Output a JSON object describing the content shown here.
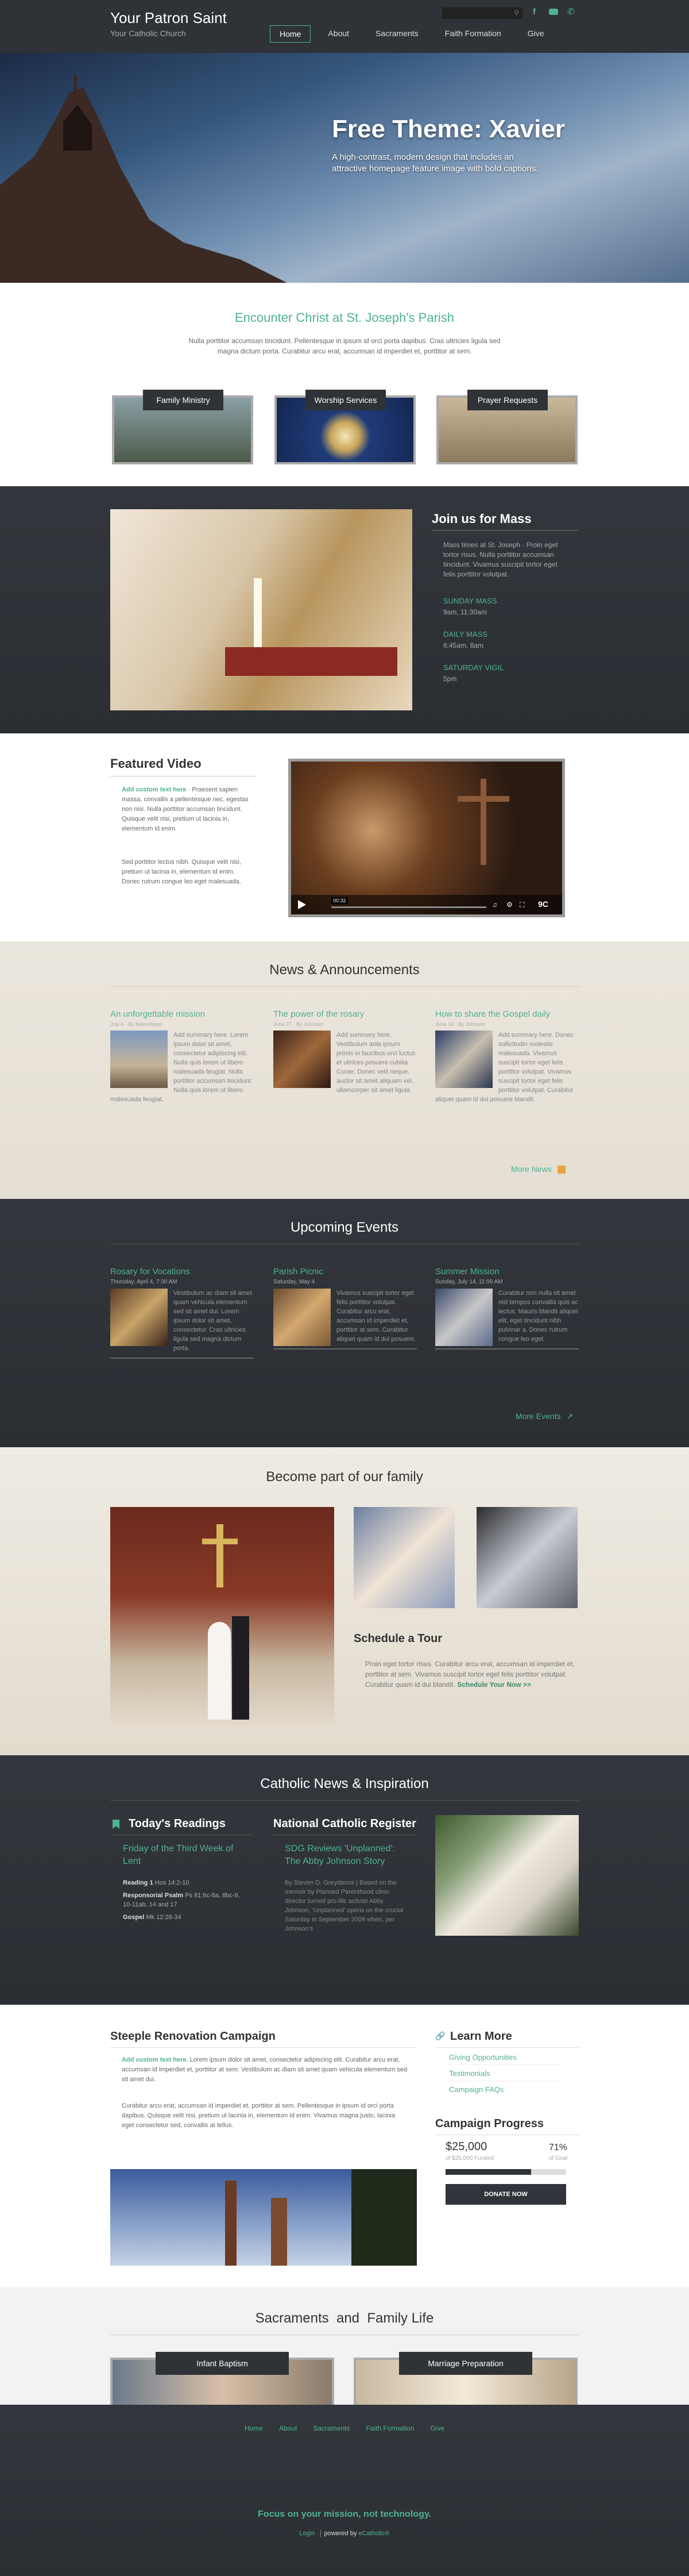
{
  "header": {
    "site_title": "Your Patron Saint",
    "site_subtitle": "Your Catholic Church",
    "nav": [
      "Home",
      "About",
      "Sacraments",
      "Faith Formation",
      "Give"
    ]
  },
  "hero": {
    "title": "Free Theme: Xavier",
    "subtitle": "A high-contrast, modern design that includes an attractive homepage feature image with bold captions."
  },
  "intro": {
    "heading": "Encounter Christ at St. Joseph's Parish",
    "text": "Nulla porttitor accumsan tincidunt. Pellentesque in ipsum id orci porta dapibus. Cras ultricies ligula sed magna dictum porta. Curabitur arcu erat, accumsan id imperdiet et, porttitor at sem.",
    "cards": [
      "Family Ministry",
      "Worship Services",
      "Prayer Requests"
    ]
  },
  "mass": {
    "heading": "Join us for Mass",
    "text": "Mass times at St. Joseph · Proin eget tortor risus. Nulla porttitor accumsan tincidunt. Vivamus suscipit tortor eget felis porttitor volutpat.",
    "times": [
      {
        "label": "SUNDAY MASS",
        "value": "9am, 11:30am"
      },
      {
        "label": "DAILY MASS",
        "value": "6:45am, 8am"
      },
      {
        "label": "SATURDAY VIGIL",
        "value": "5pm"
      }
    ]
  },
  "video": {
    "heading": "Featured Video",
    "lead": "Add custom text here",
    "text1": " · Praesent sapien massa, convallis a pellentesque nec, egestas non nisi. Nulla porttitor accumsan tincidunt. Quisque velit nisi, pretium ut lacinia in, elementum id enim.",
    "text2": "Sed porttitor lectus nibh. Quisque velit nisi, pretium ut lacinia in, elementum id enim. Donec rutrum congue leo eget malesuada.",
    "time": "00:32"
  },
  "news": {
    "heading": "News & Announcements",
    "items": [
      {
        "title": "An unforgettable mission",
        "meta": "July 6 · By tkdeveloper",
        "text": "Add summary here. Lorem ipsum dolor sit amet, consectetur adipiscing elit. Nulla quis lorem ut libero malesuada feugiat. Nulla porttitor accumsan tincidunt. Nulla quis lorem ut libero malesuada feugiat."
      },
      {
        "title": "The power of the rosary",
        "meta": "June 27 · By Johnson",
        "text": "Add summary here. Vestibulum ante ipsum primis in faucibus orci luctus et ultrices posuere cubilia Curae; Donec velit neque, auctor sit amet aliquam vel, ullamcorper sit amet ligula."
      },
      {
        "title": "How to share the Gospel daily",
        "meta": "June 14 · By Johnson",
        "text": "Add summary here. Donec sollicitudin molestie malesuada. Vivamus suscipit tortor eget felis porttitor volutpat. Vivamus suscipit tortor eget felis porttitor volutpat. Curabitur aliquet quam id dui posuere blandit."
      }
    ],
    "more": "More News"
  },
  "events": {
    "heading": "Upcoming Events",
    "items": [
      {
        "title": "Rosary for Vocations",
        "meta": "Thursday, April 4, 7:30 AM",
        "text": "Vestibulum ac diam sit amet quam vehicula elementum sed sit amet dui. Lorem ipsum dolor sit amet, consectetur. Cras ultricies ligula sed magna dictum porta."
      },
      {
        "title": "Parish Picnic",
        "meta": "Saturday, May 4",
        "text": "Vivamus suscipit tortor eget felis porttitor volutpat. Curabitur arcu erat, accumsan id imperdiet et, porttitor at sem. Curabitur aliquet quam id dui posuere."
      },
      {
        "title": "Summer Mission",
        "meta": "Sunday, July 14, 11:00 AM",
        "text": "Curabitur non nulla sit amet nisl tempus convallis quis ac lectus. Mauris blandit aliquet elit, eget tincidunt nibh pulvinar a. Donec rutrum congue leo eget."
      }
    ],
    "more": "More Events"
  },
  "family": {
    "heading": "Become part of our family",
    "tour_heading": "Schedule a Tour",
    "tour_text": "Proin eget tortor risus. Curabitur arcu erat, accumsan id imperdiet et, porttitor at sem. Vivamus suscipit tortor eget felis porttitor volutpat. Curabitur quam id dui blandit.",
    "tour_link": "Schedule Your Now >>"
  },
  "catholic": {
    "heading": "Catholic News & Inspiration",
    "readings_heading": "Today's Readings",
    "readings_title": "Friday of the Third Week of Lent",
    "readings": [
      {
        "label": "Reading 1",
        "value": "Hos 14:2-10"
      },
      {
        "label": "Responsorial Psalm",
        "value": "Ps 81:6c-8a, 8bc-9, 10-11ab, 14 and 17"
      },
      {
        "label": "Gospel",
        "value": "Mk 12:28-34"
      }
    ],
    "register_heading": "National Catholic Register",
    "register_title": "SDG Reviews 'Unplanned': The Abby Johnson Story",
    "register_text": "By Steven D. Greydanus | Based on the memoir by Planned Parenthood clinic director turned pro-life activist Abby Johnson, 'Unplanned' opens on the crucial Saturday in September 2009 when, per Johnson's"
  },
  "campaign": {
    "heading": "Steeple Renovation Campaign",
    "lead": "Add custom text here.",
    "text1": " Lorem ipsum dolor sit amet, consectetur adipiscing elit. Curabitur arcu erat, accumsan id imperdiet et, porttitor at sem. Vestibulum ac diam sit amet quam vehicula elementum sed sit amet dui.",
    "text2": "Curabitur arcu erat, accumsan id imperdiet et, porttitor at sem. Pellentesque in ipsum id orci porta dapibus. Quisque velit nisi, pretium ut lacinia in, elementum id enim. Vivamus magna justo, lacinia eget consectetur sed, convallis at tellus.",
    "learn_heading": "Learn More",
    "learn_links": [
      "Giving Opportunities",
      "Testimonials",
      "Campaign FAQs"
    ],
    "progress_heading": "Campaign Progress",
    "raised": "$25,000",
    "raised_sub": "of $35,000 Funded",
    "percent": "71%",
    "percent_sub": "of Goal",
    "progress_fraction": 0.71,
    "donate": "DONATE NOW"
  },
  "sacraments": {
    "heading": "Sacraments  and  Family Life",
    "cards": [
      "Infant Baptism",
      "Marriage Preparation"
    ]
  },
  "footer": {
    "nav": [
      "Home",
      "About",
      "Sacraments",
      "Faith Formation",
      "Give"
    ],
    "tagline": "Focus on your mission, not technology.",
    "login": "Login",
    "powered": "powered by",
    "brand": "eCatholic®"
  },
  "colors": {
    "accent": "#4fb38f",
    "dark": "#303339",
    "orange": "#e9a23b"
  }
}
